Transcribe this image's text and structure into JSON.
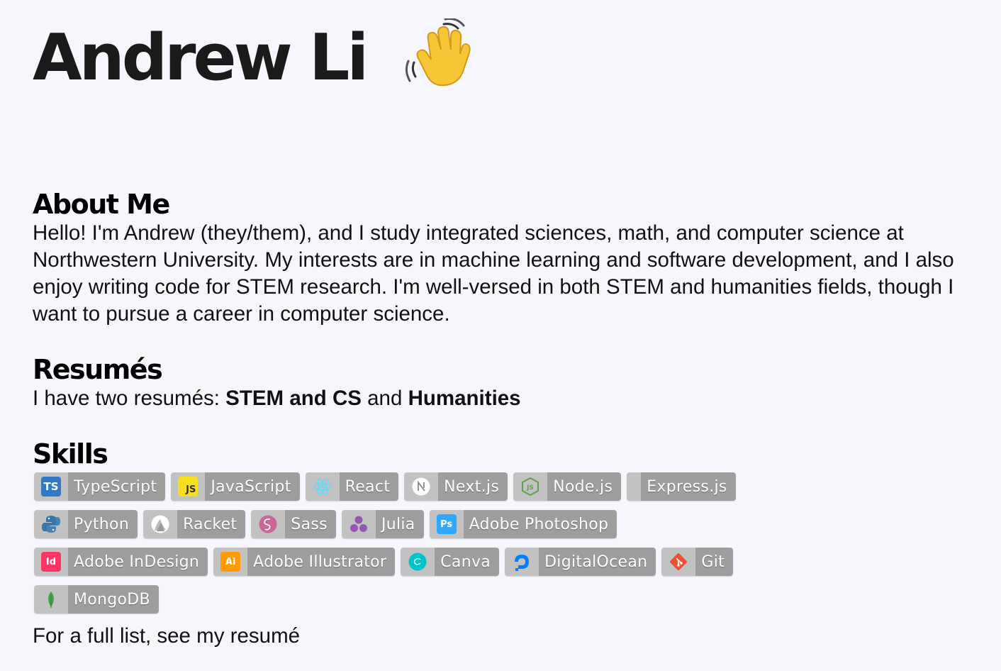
{
  "hero": {
    "title": "Andrew Li"
  },
  "about": {
    "heading": "About Me",
    "text": "Hello! I'm Andrew (they/them), and I study integrated sciences, math, and computer science at Northwestern University. My interests are in machine learning and software development, and I also enjoy writing code for STEM research. I'm well-versed in both STEM and humanities fields, though I want to pursue a career in computer science."
  },
  "resumes": {
    "heading": "Resumés",
    "prefix": "I have two resumés: ",
    "link1": "STEM and CS",
    "middle": " and ",
    "link2": "Humanities"
  },
  "skills": {
    "heading": "Skills",
    "badges": [
      {
        "label": "TypeScript",
        "icon": "typescript-icon",
        "color": "#3178c6"
      },
      {
        "label": "JavaScript",
        "icon": "javascript-icon",
        "color": "#f7df1e"
      },
      {
        "label": "React",
        "icon": "react-icon",
        "color": "#61dafb"
      },
      {
        "label": "Next.js",
        "icon": "nextjs-icon",
        "color": "#ffffff"
      },
      {
        "label": "Node.js",
        "icon": "nodejs-icon",
        "color": "#5fa04e"
      },
      {
        "label": "Express.js",
        "icon": "expressjs-icon",
        "color": "#c2c2c2"
      },
      {
        "label": "Python",
        "icon": "python-icon",
        "color": "#3776ab"
      },
      {
        "label": "Racket",
        "icon": "racket-icon",
        "color": "#ffffff"
      },
      {
        "label": "Sass",
        "icon": "sass-icon",
        "color": "#cc6699"
      },
      {
        "label": "Julia",
        "icon": "julia-icon",
        "color": "#9558b2"
      },
      {
        "label": "Adobe Photoshop",
        "icon": "photoshop-icon",
        "color": "#31a8ff"
      },
      {
        "label": "Adobe InDesign",
        "icon": "indesign-icon",
        "color": "#ff3366"
      },
      {
        "label": "Adobe Illustrator",
        "icon": "illustrator-icon",
        "color": "#ff9a00"
      },
      {
        "label": "Canva",
        "icon": "canva-icon",
        "color": "#00c4cc"
      },
      {
        "label": "DigitalOcean",
        "icon": "digitalocean-icon",
        "color": "#0080ff"
      },
      {
        "label": "Git",
        "icon": "git-icon",
        "color": "#f05032"
      },
      {
        "label": "MongoDB",
        "icon": "mongodb-icon",
        "color": "#47a248"
      }
    ],
    "footer_prefix": "For a full list, see my ",
    "footer_link": "resumé"
  }
}
